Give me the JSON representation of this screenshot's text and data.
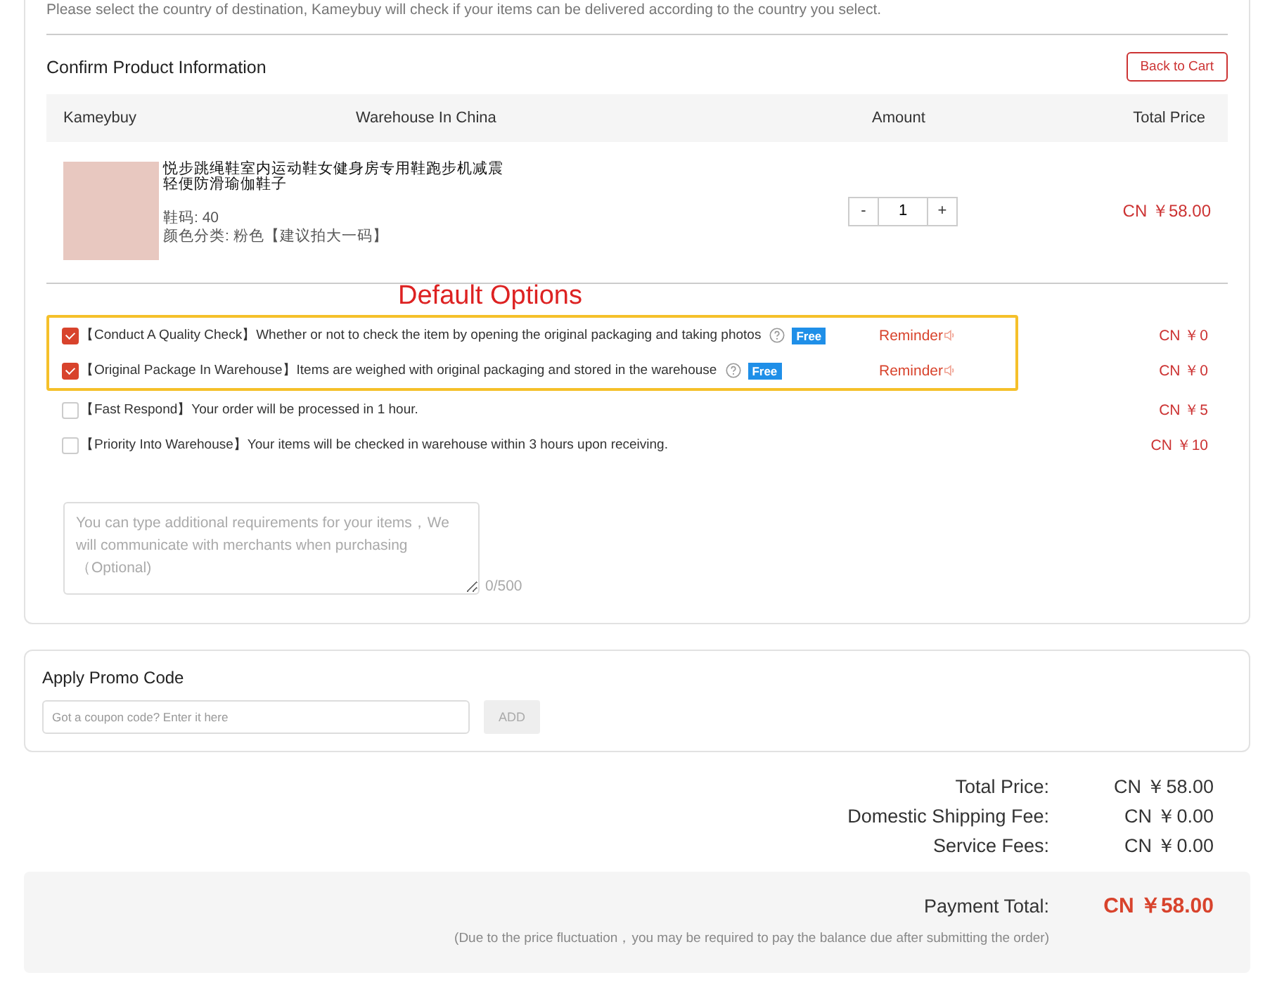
{
  "intro": "Please select the country of destination, Kameybuy will check if your items can be delivered according to the country you select.",
  "product_section": {
    "title": "Confirm Product Information",
    "back_button": "Back to Cart",
    "columns": [
      "Kameybuy",
      "Warehouse In China",
      "Amount",
      "Total Price"
    ],
    "item": {
      "name": "悦步跳绳鞋室内运动鞋女健身房专用鞋跑步机减震轻便防滑瑜伽鞋子",
      "specs": [
        "鞋码: 40",
        "颜色分类: 粉色【建议拍大一码】"
      ],
      "minus": "-",
      "quantity": "1",
      "plus": "+",
      "price": "CN ￥58.00"
    }
  },
  "default_options": {
    "label": "Default Options",
    "options": [
      {
        "title": "【Conduct A Quality Check】",
        "text": "Whether or not to check the item by opening the original packaging and taking photos",
        "checked": true,
        "badge": "Free",
        "reminder": "Reminder",
        "price": "CN ￥0"
      },
      {
        "title": "【Original Package In Warehouse】",
        "text": "Items are weighed with original packaging and stored in the warehouse",
        "checked": true,
        "badge": "Free",
        "reminder": "Reminder",
        "price": "CN ￥0"
      }
    ]
  },
  "options": [
    {
      "title": "【Fast Respond】",
      "text": "Your order will be processed in 1 hour.",
      "checked": false,
      "price": "CN ￥5"
    },
    {
      "title": "【Priority Into Warehouse】",
      "text": "Your items will be checked in warehouse within 3 hours upon receiving.",
      "checked": false,
      "price": "CN ￥10"
    }
  ],
  "remarks": {
    "placeholder": "You can type additional requirements for your items，We will communicate with merchants when purchasing（Optional)",
    "counter": "0/500"
  },
  "promo": {
    "title": "Apply Promo Code",
    "placeholder": "Got a coupon code? Enter it here",
    "button": "ADD"
  },
  "summary": [
    {
      "label": "Total Price:",
      "value": "CN ￥58.00"
    },
    {
      "label": "Domestic Shipping Fee:",
      "value": "CN ￥0.00"
    },
    {
      "label": "Service Fees:",
      "value": "CN ￥0.00"
    }
  ],
  "payment": {
    "label": "Payment Total:",
    "value": "CN ￥58.00",
    "note": "(Due to the price fluctuation，you may be required to pay the balance due after submitting the order)"
  }
}
